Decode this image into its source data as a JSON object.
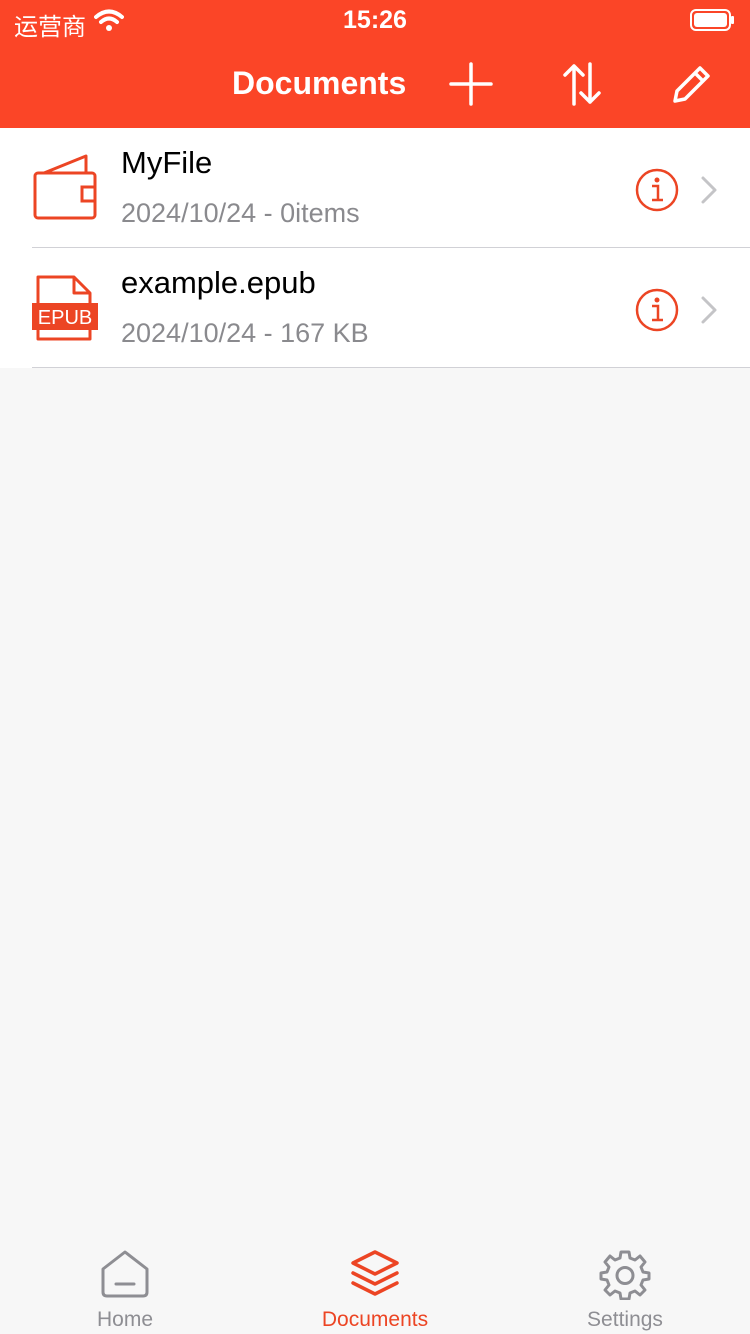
{
  "status_bar": {
    "carrier": "运营商",
    "time": "15:26",
    "icons": [
      "wifi-icon",
      "battery-icon"
    ]
  },
  "nav": {
    "title": "Documents",
    "buttons": [
      "plus-icon",
      "sort-icon",
      "pencil-icon"
    ]
  },
  "files": [
    {
      "name": "MyFile",
      "meta": "2024/10/24 - 0items",
      "icon": "folder-icon"
    },
    {
      "name": "example.epub",
      "meta": "2024/10/24 - 167 KB",
      "icon": "epub-file-icon",
      "badge": "EPUB"
    }
  ],
  "tabs": [
    {
      "label": "Home",
      "icon": "home-icon",
      "active": false
    },
    {
      "label": "Documents",
      "icon": "layers-icon",
      "active": true
    },
    {
      "label": "Settings",
      "icon": "gear-icon",
      "active": false
    }
  ],
  "colors": {
    "accent": "#fb4527",
    "background": "#f7f7f7",
    "secondary_text": "#8a8a8e",
    "inactive_tab": "#8e8e93"
  }
}
